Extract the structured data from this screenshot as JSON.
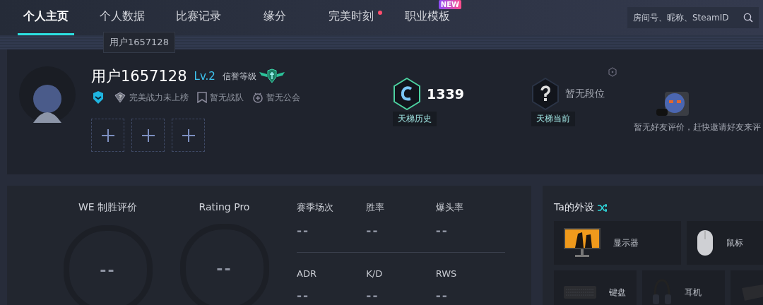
{
  "nav": {
    "tabs": [
      {
        "label": "个人主页",
        "selected": true,
        "notify": false
      },
      {
        "label": "个人数据",
        "selected": false,
        "notify": false
      },
      {
        "label": "比赛记录",
        "selected": false,
        "notify": false
      },
      {
        "label": "缘分",
        "selected": false,
        "notify": false
      },
      {
        "label": "完美时刻",
        "selected": false,
        "notify": true
      },
      {
        "label": "职业模板",
        "selected": false,
        "notify": false,
        "badge": "NEW"
      }
    ],
    "search": {
      "placeholder": "房间号、昵称、SteamID"
    }
  },
  "tooltip": "用户1657128",
  "profile": {
    "name": "用户1657128",
    "level": "Lv.2",
    "credit_label": "信誉等级",
    "tags": [
      {
        "kind": "power",
        "label": "完美战力未上榜"
      },
      {
        "kind": "team",
        "label": "暂无战队"
      },
      {
        "kind": "guild",
        "label": "暂无公会"
      }
    ],
    "slots": [
      {
        "kind": "empty"
      },
      {
        "kind": "empty"
      },
      {
        "kind": "empty"
      }
    ],
    "ladder": [
      {
        "kind": "score",
        "value": "1339",
        "label": "天梯历史"
      },
      {
        "kind": "unranked",
        "value": "暂无段位",
        "label": "天梯当前"
      }
    ],
    "friend_review": "暂无好友评价，赶快邀请好友来评"
  },
  "stats": {
    "ratings": [
      {
        "label": "WE 制胜评价",
        "value": "--"
      },
      {
        "label": "Rating Pro",
        "value": "--"
      }
    ],
    "metrics": [
      [
        {
          "label": "赛季场次",
          "value": "--"
        },
        {
          "label": "胜率",
          "value": "--"
        },
        {
          "label": "爆头率",
          "value": "--"
        }
      ],
      [
        {
          "label": "ADR",
          "value": "--"
        },
        {
          "label": "K/D",
          "value": "--"
        },
        {
          "label": "RWS",
          "value": "--"
        }
      ]
    ]
  },
  "gear": {
    "title": "Ta的外设",
    "items": [
      {
        "kind": "monitor",
        "label": "显示器"
      },
      {
        "kind": "mouse",
        "label": "鼠标"
      },
      {
        "kind": "keyboard",
        "label": "键盘"
      },
      {
        "kind": "headset",
        "label": "耳机"
      },
      {
        "kind": "mousepad"
      }
    ]
  }
}
